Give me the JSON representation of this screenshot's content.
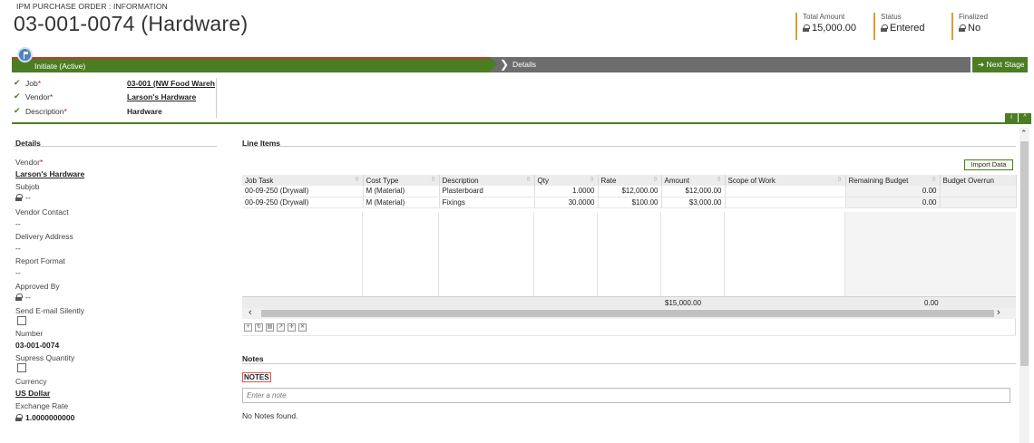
{
  "header": {
    "breadcrumb": "IPM PURCHASE ORDER : INFORMATION",
    "title": "03-001-0074 (Hardware)",
    "summary": [
      {
        "label": "Total Amount",
        "value": "15,000.00"
      },
      {
        "label": "Status",
        "value": "Entered"
      },
      {
        "label": "Finalized",
        "value": "No"
      }
    ],
    "accent_color": "#e59a2f"
  },
  "stages": {
    "active": "Initiate (Active)",
    "next": "Details",
    "next_button": "Next Stage",
    "active_color": "#4b7d23",
    "inactive_color": "#6d6d6d"
  },
  "header_fields": [
    {
      "label": "Job",
      "value": "03-001 (NW Food Wareh"
    },
    {
      "label": "Vendor",
      "value": "Larson's Hardware"
    },
    {
      "label": "Description",
      "value": "Hardware"
    }
  ],
  "corner_buttons": {
    "info": "i",
    "collapse": "^"
  },
  "details": {
    "title": "Details",
    "vendor_label": "Vendor",
    "vendor_value": "Larson's Hardware",
    "subjob_label": "Subjob",
    "subjob_value": "--",
    "vendor_contact_label": "Vendor Contact",
    "vendor_contact_value": "--",
    "delivery_address_label": "Delivery Address",
    "delivery_address_value": "--",
    "report_format_label": "Report Format",
    "report_format_value": "--",
    "approved_by_label": "Approved By",
    "approved_by_value": "--",
    "send_email_label": "Send E-mail Silently",
    "number_label": "Number",
    "number_value": "03-001-0074",
    "supress_label": "Supress Quantity",
    "currency_label": "Currency",
    "currency_value": "US Dollar",
    "exchange_rate_label": "Exchange Rate",
    "exchange_rate_value": "1.0000000000"
  },
  "line_items": {
    "title": "Line Items",
    "import_button": "Import Data",
    "columns": [
      "Job Task",
      "Cost Type",
      "Description",
      "Qty",
      "Rate",
      "Amount",
      "Scope of Work",
      "Remaining Budget",
      "Budget Overrun"
    ],
    "rows": [
      [
        "00-09-250 (Drywall)",
        "M (Material)",
        "Plasterboard",
        "1.0000",
        "$12,000.00",
        "$12,000.00",
        "",
        "0.00",
        ""
      ],
      [
        "00-09-250 (Drywall)",
        "M (Material)",
        "Fixings",
        "30.0000",
        "$100.00",
        "$3,000.00",
        "",
        "0.00",
        ""
      ]
    ],
    "total_amount": "$15,000.00",
    "total_remaining": "0.00"
  },
  "notes": {
    "title": "Notes",
    "tab": "NOTES",
    "placeholder": "Enter a note",
    "empty": "No Notes found."
  }
}
